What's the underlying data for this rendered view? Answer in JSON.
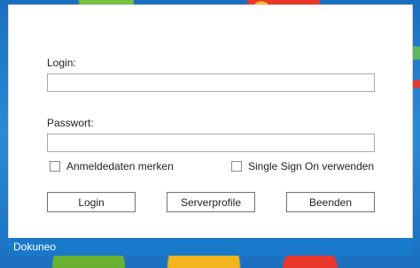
{
  "form": {
    "login_label": "Login:",
    "login_value": "",
    "password_label": "Passwort:",
    "password_value": "",
    "remember_label": "Anmeldedaten merken",
    "remember_checked": false,
    "sso_label": "Single Sign On verwenden",
    "sso_checked": false
  },
  "buttons": {
    "login": "Login",
    "serverprofile": "Serverprofile",
    "quit": "Beenden"
  },
  "statusbar": {
    "app_name": "Dokuneo",
    "color": "#1979ca"
  }
}
